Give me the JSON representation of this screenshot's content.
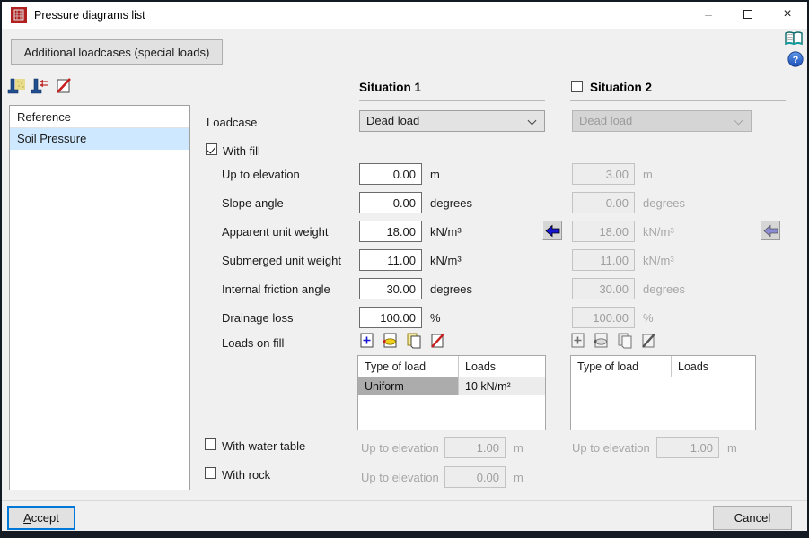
{
  "window": {
    "title": "Pressure diagrams list",
    "controls": {
      "minimize": "–",
      "close": "×"
    }
  },
  "header": {
    "additional_loadcases_button": "Additional loadcases (special loads)"
  },
  "icons": {
    "list_toolbar": [
      "wall-fill-icon",
      "wall-pressure-icon",
      "delete-diagram-icon"
    ],
    "loads_toolbar": [
      "add-icon",
      "edit-icon",
      "copy-icon",
      "delete-icon"
    ],
    "transfer": "left-arrow-icon",
    "side": [
      "manual-book-icon",
      "help-icon"
    ]
  },
  "reference_list": {
    "header": "Reference",
    "items": [
      {
        "label": "Soil Pressure",
        "selected": true
      }
    ]
  },
  "situations": {
    "s1": {
      "title": "Situation 1",
      "enabled": true,
      "loadcase": "Dead load"
    },
    "s2": {
      "title": "Situation 2",
      "enabled": false,
      "loadcase": "Dead load",
      "checked": false
    }
  },
  "form": {
    "loadcase_label": "Loadcase",
    "with_fill": {
      "label": "With fill",
      "checked": true
    },
    "rows": {
      "up_to_elevation": {
        "label": "Up to elevation",
        "unit": "m",
        "s1": "0.00",
        "s2": "3.00"
      },
      "slope_angle": {
        "label": "Slope angle",
        "unit": "degrees",
        "s1": "0.00",
        "s2": "0.00"
      },
      "apparent_unit_weight": {
        "label": "Apparent unit weight",
        "unit": "kN/m³",
        "s1": "18.00",
        "s2": "18.00"
      },
      "submerged_unit_weight": {
        "label": "Submerged unit weight",
        "unit": "kN/m³",
        "s1": "11.00",
        "s2": "11.00"
      },
      "internal_friction_angle": {
        "label": "Internal friction angle",
        "unit": "degrees",
        "s1": "30.00",
        "s2": "30.00"
      },
      "drainage_loss": {
        "label": "Drainage loss",
        "unit": "%",
        "s1": "100.00",
        "s2": "100.00"
      }
    },
    "loads_on_fill_label": "Loads on fill",
    "loads_table": {
      "headers": [
        "Type of load",
        "Loads"
      ],
      "s1_rows": [
        [
          "Uniform",
          "10 kN/m²"
        ]
      ],
      "s2_rows": []
    },
    "with_water_table": {
      "label": "With water table",
      "checked": false,
      "sub_label": "Up to elevation",
      "unit": "m",
      "s1": "1.00",
      "s2": "1.00"
    },
    "with_rock": {
      "label": "With rock",
      "checked": false,
      "sub_label": "Up to elevation",
      "unit": "m",
      "s1": "0.00"
    }
  },
  "footer": {
    "accept": "Accept",
    "cancel": "Cancel"
  },
  "colors": {
    "accent_arrow": "#1616d1",
    "selection": "#cde8ff",
    "focus_border": "#0078d7",
    "app_icon_red": "#b02020"
  }
}
